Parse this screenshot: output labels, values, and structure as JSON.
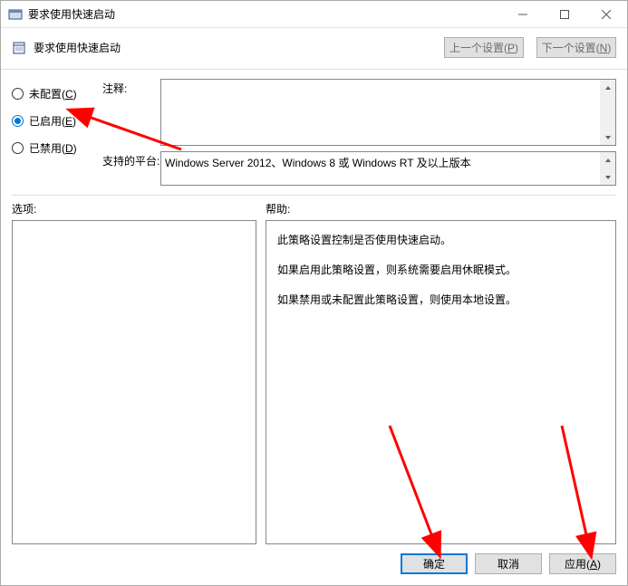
{
  "window": {
    "title": "要求使用快速启动"
  },
  "header": {
    "title": "要求使用快速启动",
    "prev_setting_label": "上一个设置(P)",
    "prev_setting_hotkey": "P",
    "next_setting_label": "下一个设置(N)",
    "next_setting_hotkey": "N"
  },
  "radios": {
    "not_configured": {
      "label": "未配置(C)",
      "hotkey": "C",
      "selected": false
    },
    "enabled": {
      "label": "已启用(E)",
      "hotkey": "E",
      "selected": true
    },
    "disabled": {
      "label": "已禁用(D)",
      "hotkey": "D",
      "selected": false
    }
  },
  "fields": {
    "comment_label": "注释:",
    "comment_value": "",
    "platform_label": "支持的平台:",
    "platform_value": "Windows Server 2012、Windows 8 或 Windows RT 及以上版本"
  },
  "sections": {
    "options_label": "选项:",
    "help_label": "帮助:"
  },
  "help": {
    "p1": "此策略设置控制是否使用快速启动。",
    "p2": "如果启用此策略设置，则系统需要启用休眠模式。",
    "p3": "如果禁用或未配置此策略设置，则使用本地设置。"
  },
  "footer": {
    "ok": "确定",
    "cancel": "取消",
    "apply_label": "应用(A)",
    "apply_hotkey": "A"
  }
}
